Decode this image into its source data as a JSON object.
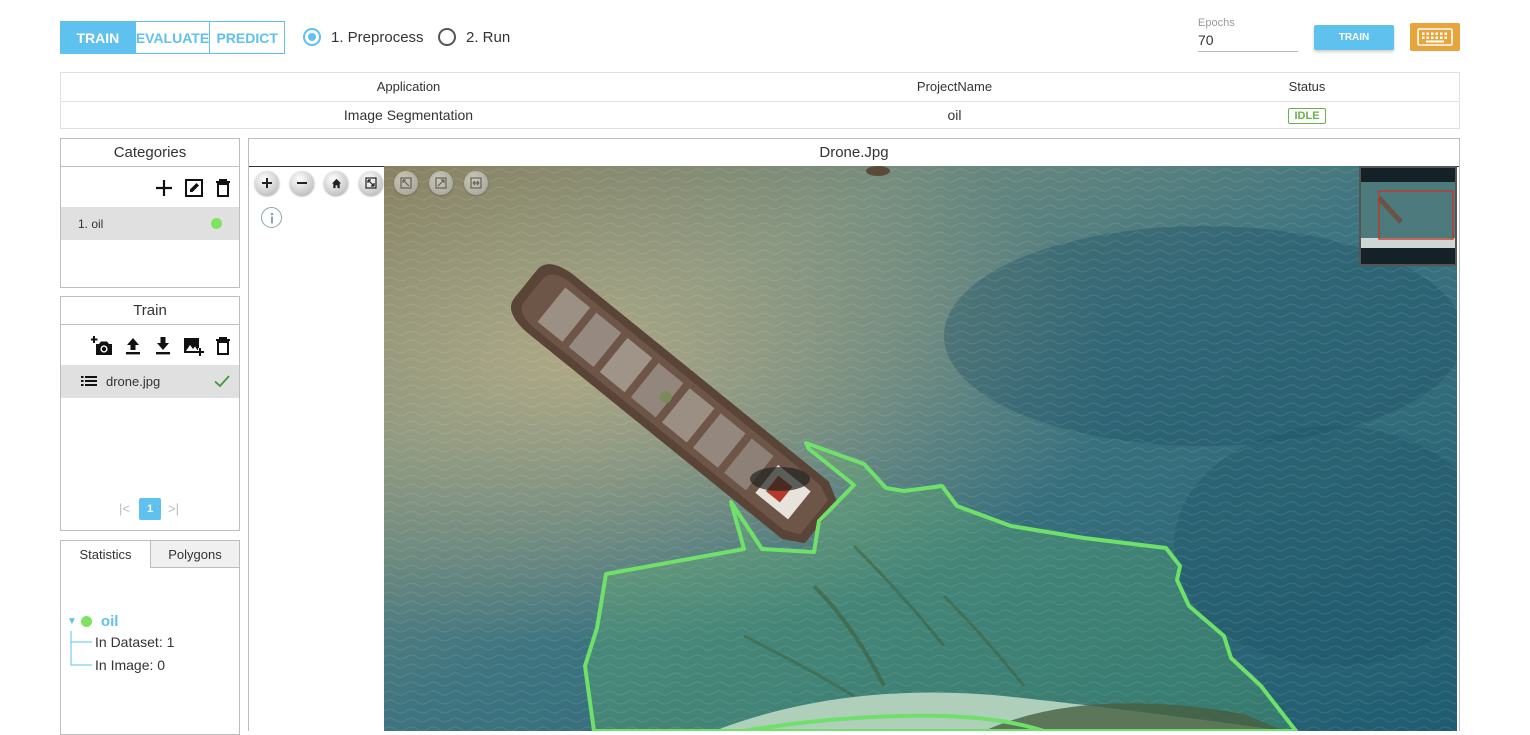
{
  "mode_tabs": [
    "TRAIN",
    "EVALUATE",
    "PREDICT"
  ],
  "active_mode": "TRAIN",
  "steps": [
    {
      "label": "1. Preprocess",
      "selected": true
    },
    {
      "label": "2. Run",
      "selected": false
    }
  ],
  "epochs": {
    "label": "Epochs",
    "value": "70"
  },
  "train_button": "TRAIN",
  "colors": {
    "accent": "#5ec1ee",
    "keyboard_button": "#e8a43c",
    "status_idle": "#6ab04c",
    "category_dot": "#7ee35f",
    "polygon": "#6fe06a"
  },
  "info_table": {
    "headers": [
      "Application",
      "ProjectName",
      "Status"
    ],
    "row": {
      "application": "Image Segmentation",
      "project": "oil",
      "status": "IDLE"
    }
  },
  "categories": {
    "title": "Categories",
    "icons": [
      "plus-icon",
      "edit-icon",
      "trash-icon"
    ],
    "items": [
      {
        "label": "1. oil",
        "color": "#7ee35f"
      }
    ]
  },
  "train_panel": {
    "title": "Train",
    "icons": [
      "add-photo-icon",
      "upload-icon",
      "download-icon",
      "add-image-icon",
      "trash-icon"
    ],
    "items": [
      {
        "label": "drone.jpg",
        "status_icon": "check-icon"
      }
    ],
    "pager": {
      "current": "1"
    }
  },
  "stats": {
    "tabs": [
      "Statistics",
      "Polygons"
    ],
    "active_tab": "Statistics",
    "category": "oil",
    "in_dataset": "In Dataset: 1",
    "in_image": "In Image: 0"
  },
  "viewer": {
    "title": "Drone.Jpg",
    "controls": [
      "zoom-in-icon",
      "zoom-out-icon",
      "home-icon",
      "fullscreen-icon",
      "rotate-left-icon",
      "rotate-right-icon",
      "flip-icon",
      "info-icon"
    ]
  }
}
